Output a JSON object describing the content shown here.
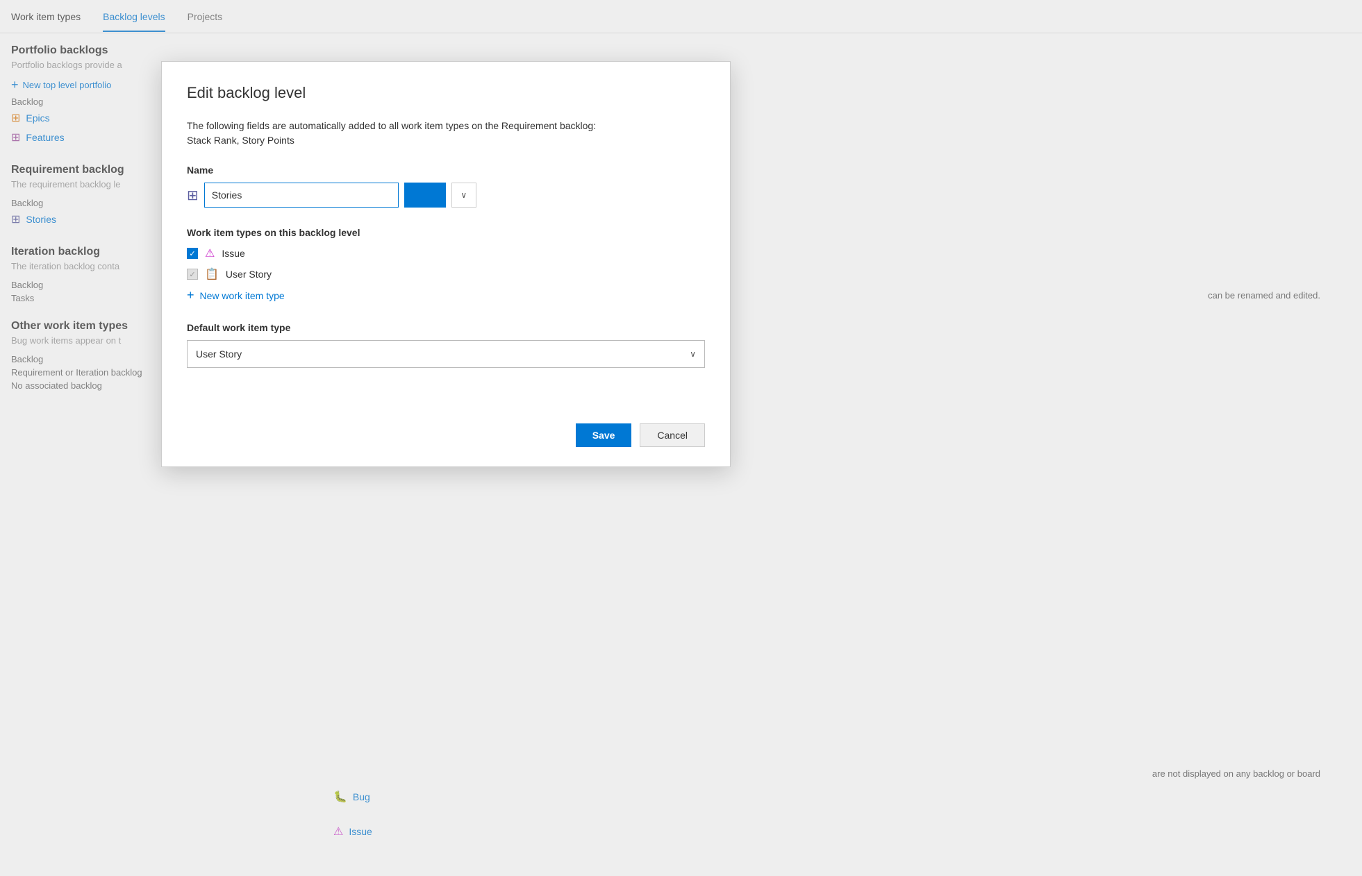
{
  "nav": {
    "tabs": [
      {
        "label": "Work item types",
        "active": false
      },
      {
        "label": "Backlog levels",
        "active": true
      },
      {
        "label": "Projects",
        "active": false
      }
    ]
  },
  "background": {
    "portfolio": {
      "heading": "Portfolio backlogs",
      "desc": "Portfolio backlogs provide a",
      "addLink": "New top level portfolio",
      "backlogLabel": "Backlog",
      "epicsLabel": "Epics",
      "featuresLabel": "Features"
    },
    "requirement": {
      "heading": "Requirement backlog",
      "desc": "The requirement backlog le",
      "backlogLabel": "Backlog",
      "storiesLabel": "Stories",
      "rightText": "can be renamed and edited."
    },
    "iteration": {
      "heading": "Iteration backlog",
      "desc": "The iteration backlog conta",
      "backlogLabel": "Backlog",
      "tasksLabel": "Tasks"
    },
    "other": {
      "heading": "Other work item types",
      "desc": "Bug work items appear on t",
      "backlogLabel": "Backlog",
      "reqIterLabel": "Requirement or Iteration backlog",
      "noAssocLabel": "No associated backlog",
      "bugLabel": "Bug",
      "issueLabel": "Issue",
      "rightText": "are not displayed on any backlog or board"
    }
  },
  "dialog": {
    "title": "Edit backlog level",
    "infoLine1": "The following fields are automatically added to all work item types on the Requirement backlog:",
    "infoLine2": "Stack Rank, Story Points",
    "nameLabel": "Name",
    "nameValue": "Stories",
    "witSectionLabel": "Work item types on this backlog level",
    "witItems": [
      {
        "label": "Issue",
        "checked": true,
        "disabled": false,
        "icon": "⚠"
      },
      {
        "label": "User Story",
        "checked": true,
        "disabled": true,
        "icon": "📋"
      }
    ],
    "addWitLabel": "New work item type",
    "defaultWitLabel": "Default work item type",
    "defaultWitValue": "User Story",
    "saveLabel": "Save",
    "cancelLabel": "Cancel"
  },
  "icons": {
    "plus": "+",
    "chevronDown": "∨",
    "epicsColor": "#e07d12",
    "featuresColor": "#a050a0",
    "storiesColor": "#5c5ea0",
    "bugColor": "#cc3333",
    "issueColor": "#cc33cc"
  }
}
